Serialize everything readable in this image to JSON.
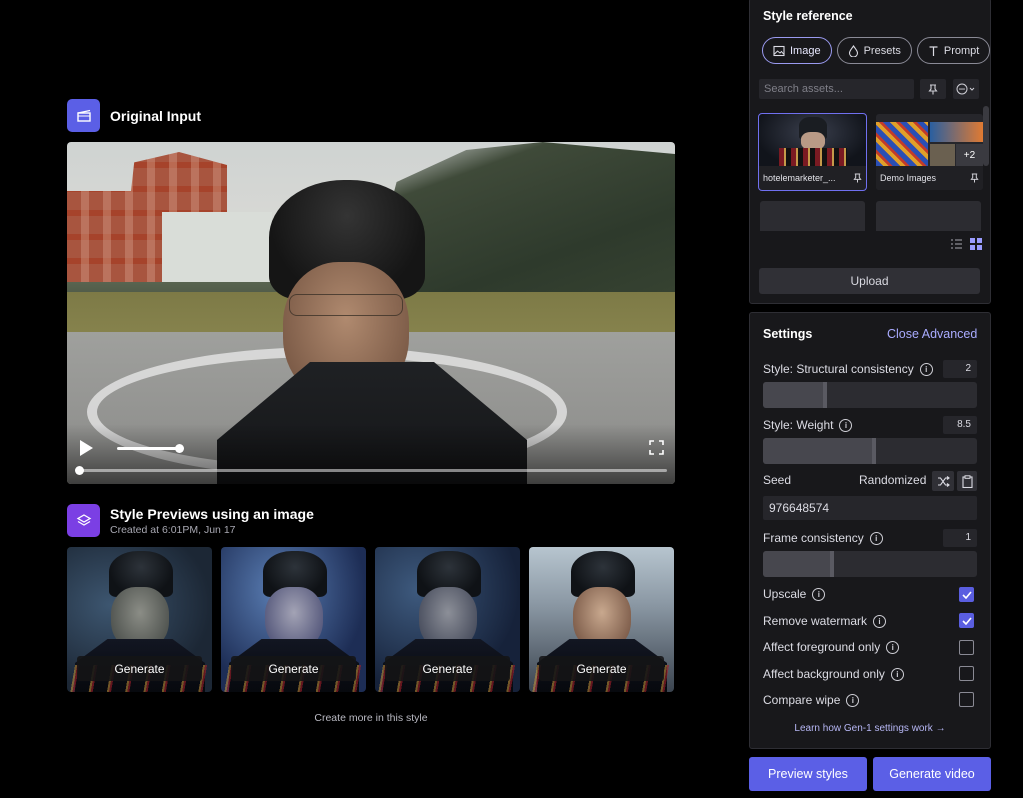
{
  "original_input": {
    "title": "Original Input"
  },
  "style_previews": {
    "title": "Style Previews using an image",
    "subtitle": "Created at 6:01PM, Jun 17",
    "generate_labels": [
      "Generate",
      "Generate",
      "Generate",
      "Generate"
    ],
    "create_more": "Create more in this style"
  },
  "style_reference": {
    "title": "Style reference",
    "tabs": [
      {
        "label": "Image",
        "icon": "image-icon",
        "active": true
      },
      {
        "label": "Presets",
        "icon": "drop-icon",
        "active": false
      },
      {
        "label": "Prompt",
        "icon": "text-icon",
        "active": false
      }
    ],
    "search_placeholder": "Search assets...",
    "assets": [
      {
        "name": "hotelemarketer_...",
        "selected": true
      },
      {
        "name": "Demo Images",
        "badge": "+2",
        "selected": false
      }
    ],
    "upload_label": "Upload"
  },
  "settings": {
    "title": "Settings",
    "close_advanced": "Close Advanced",
    "structural": {
      "label": "Style: Structural consistency",
      "value": "2",
      "level": 0.3
    },
    "weight": {
      "label": "Style: Weight",
      "value": "8.5",
      "level": 0.53
    },
    "seed": {
      "label": "Seed",
      "mode": "Randomized",
      "value": "976648574"
    },
    "frame": {
      "label": "Frame consistency",
      "value": "1",
      "level": 0.33
    },
    "checks": [
      {
        "label": "Upscale",
        "checked": true
      },
      {
        "label": "Remove watermark",
        "checked": true
      },
      {
        "label": "Affect foreground only",
        "checked": false
      },
      {
        "label": "Affect background only",
        "checked": false
      },
      {
        "label": "Compare wipe",
        "checked": false
      }
    ],
    "learn_link": "Learn how Gen-1 settings work →"
  },
  "actions": {
    "preview": "Preview styles",
    "generate": "Generate video"
  },
  "colors": {
    "accent": "#5b5fe6",
    "original_icon": "#5b5fe6",
    "preview_icon": "#7b3fe4"
  }
}
